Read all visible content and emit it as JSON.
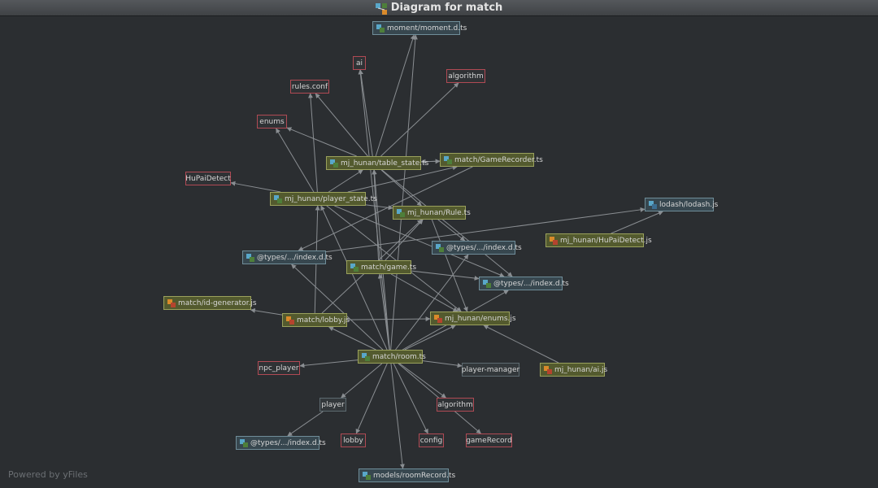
{
  "window": {
    "title": "Diagram for match",
    "title_icon": "diagram-icon"
  },
  "footer": "Powered by yFiles",
  "colors": {
    "background": "#2b2e31",
    "edge": "#8a8e92",
    "plain_border": "#b04a54",
    "ts_fill": "#535a2e",
    "lib_fill": "#37474f"
  },
  "nodes": [
    {
      "id": "moment",
      "label": "moment/moment.d.ts",
      "kind": "lib",
      "icon": "ts-file-icon"
    },
    {
      "id": "ai",
      "label": "ai",
      "kind": "plain"
    },
    {
      "id": "algorithm1",
      "label": "algorithm",
      "kind": "plain"
    },
    {
      "id": "rulesconf",
      "label": "rules.conf",
      "kind": "plain"
    },
    {
      "id": "enums",
      "label": "enums",
      "kind": "plain"
    },
    {
      "id": "tablestate",
      "label": "mj_hunan/table_state.ts",
      "kind": "ts",
      "icon": "ts-file-icon"
    },
    {
      "id": "gamerecorder",
      "label": "match/GameRecorder.ts",
      "kind": "ts",
      "icon": "ts-file-icon"
    },
    {
      "id": "hupaidetect",
      "label": "HuPaiDetect",
      "kind": "plain"
    },
    {
      "id": "playerstate",
      "label": "mj_hunan/player_state.ts",
      "kind": "ts",
      "icon": "ts-file-icon"
    },
    {
      "id": "lodash",
      "label": "lodash/lodash.js",
      "kind": "lib",
      "icon": "js-lib-icon"
    },
    {
      "id": "rule",
      "label": "mj_hunan/Rule.ts",
      "kind": "ts",
      "icon": "ts-file-icon"
    },
    {
      "id": "hupaidetectjs",
      "label": "mj_hunan/HuPaiDetect.js",
      "kind": "js",
      "icon": "js-file-icon"
    },
    {
      "id": "types1",
      "label": "@types/.../index.d.ts",
      "kind": "lib",
      "icon": "ts-file-icon"
    },
    {
      "id": "types2",
      "label": "@types/.../index.d.ts",
      "kind": "lib",
      "icon": "ts-file-icon"
    },
    {
      "id": "game",
      "label": "match/game.ts",
      "kind": "ts",
      "icon": "ts-file-icon"
    },
    {
      "id": "types3",
      "label": "@types/.../index.d.ts",
      "kind": "lib",
      "icon": "ts-file-icon"
    },
    {
      "id": "idgen",
      "label": "match/id-generator.js",
      "kind": "js",
      "icon": "js-file-icon"
    },
    {
      "id": "lobbyjs",
      "label": "match/lobby.js",
      "kind": "js",
      "icon": "js-file-icon"
    },
    {
      "id": "enumsjs",
      "label": "mj_hunan/enums.js",
      "kind": "js",
      "icon": "js-file-icon"
    },
    {
      "id": "room",
      "label": "match/room.ts",
      "kind": "ts",
      "icon": "ts-file-icon"
    },
    {
      "id": "npcplayer",
      "label": "npc_player",
      "kind": "plain"
    },
    {
      "id": "playermanager",
      "label": "player-manager",
      "kind": "grey"
    },
    {
      "id": "aijs",
      "label": "mj_hunan/ai.js",
      "kind": "js",
      "icon": "js-file-icon"
    },
    {
      "id": "player",
      "label": "player",
      "kind": "grey"
    },
    {
      "id": "algorithm2",
      "label": "algorithm",
      "kind": "plain"
    },
    {
      "id": "types4",
      "label": "@types/.../index.d.ts",
      "kind": "lib",
      "icon": "ts-file-icon"
    },
    {
      "id": "lobby",
      "label": "lobby",
      "kind": "plain"
    },
    {
      "id": "config",
      "label": "config",
      "kind": "plain"
    },
    {
      "id": "gamerecord",
      "label": "gameRecord",
      "kind": "plain"
    },
    {
      "id": "roomrecord",
      "label": "models/roomRecord.ts",
      "kind": "lib",
      "icon": "ts-file-icon"
    }
  ],
  "edges": [
    [
      "tablestate",
      "moment"
    ],
    [
      "tablestate",
      "ai"
    ],
    [
      "tablestate",
      "algorithm1"
    ],
    [
      "tablestate",
      "rulesconf"
    ],
    [
      "tablestate",
      "enums"
    ],
    [
      "tablestate",
      "gamerecorder"
    ],
    [
      "tablestate",
      "rule"
    ],
    [
      "tablestate",
      "types3"
    ],
    [
      "playerstate",
      "hupaidetect"
    ],
    [
      "playerstate",
      "enums"
    ],
    [
      "playerstate",
      "tablestate"
    ],
    [
      "playerstate",
      "gamerecorder"
    ],
    [
      "playerstate",
      "rule"
    ],
    [
      "playerstate",
      "rulesconf"
    ],
    [
      "playerstate",
      "enumsjs"
    ],
    [
      "playerstate",
      "types3"
    ],
    [
      "gamerecorder",
      "tablestate"
    ],
    [
      "gamerecorder",
      "types2"
    ],
    [
      "rule",
      "types1"
    ],
    [
      "rule",
      "enumsjs"
    ],
    [
      "game",
      "tablestate"
    ],
    [
      "game",
      "rule"
    ],
    [
      "game",
      "types3"
    ],
    [
      "game",
      "enumsjs"
    ],
    [
      "lobbyjs",
      "idgen"
    ],
    [
      "lobbyjs",
      "rule"
    ],
    [
      "lobbyjs",
      "enumsjs"
    ],
    [
      "lobbyjs",
      "playerstate"
    ],
    [
      "room",
      "moment"
    ],
    [
      "room",
      "ai"
    ],
    [
      "room",
      "tablestate"
    ],
    [
      "room",
      "game"
    ],
    [
      "room",
      "types1"
    ],
    [
      "room",
      "types2"
    ],
    [
      "room",
      "npcplayer"
    ],
    [
      "room",
      "playermanager"
    ],
    [
      "room",
      "player"
    ],
    [
      "room",
      "algorithm2"
    ],
    [
      "room",
      "lobby"
    ],
    [
      "room",
      "config"
    ],
    [
      "room",
      "gamerecord"
    ],
    [
      "room",
      "roomrecord"
    ],
    [
      "room",
      "enumsjs"
    ],
    [
      "room",
      "types3"
    ],
    [
      "room",
      "lobbyjs"
    ],
    [
      "room",
      "playerstate"
    ],
    [
      "aijs",
      "enumsjs"
    ],
    [
      "types2",
      "lodash"
    ],
    [
      "hupaidetectjs",
      "lodash"
    ],
    [
      "player",
      "types4"
    ]
  ]
}
